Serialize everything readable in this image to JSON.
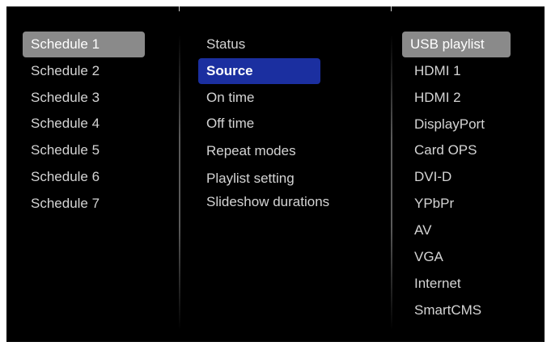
{
  "colors": {
    "background": "#000000",
    "text": "#d4d4d4",
    "selected_gray": "#8a8a8a",
    "selected_blue": "#1b2fa0"
  },
  "schedules": {
    "selected": "Schedule 1",
    "items": [
      "Schedule 1",
      "Schedule 2",
      "Schedule 3",
      "Schedule 4",
      "Schedule 5",
      "Schedule 6",
      "Schedule 7"
    ]
  },
  "settings": {
    "selected": "Source",
    "items": [
      "Status",
      "Source",
      "On time",
      "Off time",
      "Repeat modes",
      "Playlist setting",
      "Slideshow durations"
    ]
  },
  "sources": {
    "selected": "USB playlist",
    "items": [
      "USB playlist",
      "HDMI 1",
      "HDMI 2",
      "DisplayPort",
      "Card OPS",
      "DVI-D",
      "YPbPr",
      "AV",
      "VGA",
      "Internet",
      "SmartCMS"
    ]
  }
}
